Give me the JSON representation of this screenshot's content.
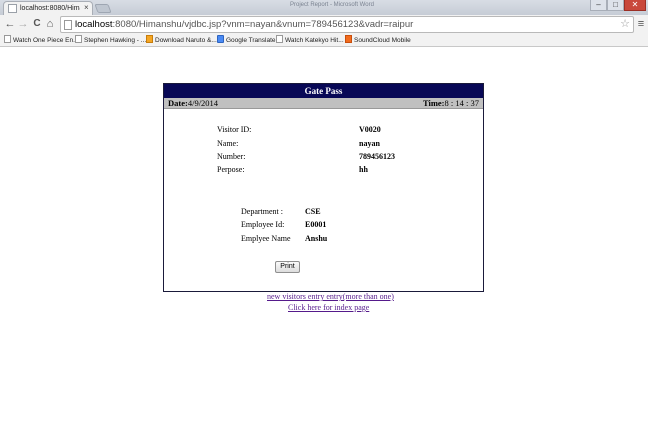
{
  "browser": {
    "tab_title": "localhost:8080/Himanshu",
    "tab_close": "×",
    "window_title": "Project Report - Microsoft Word",
    "controls": {
      "minimize": "–",
      "maximize": "□",
      "close": "✕"
    },
    "nav": {
      "back": "←",
      "forward": "→",
      "reload": "C",
      "home": "⌂"
    },
    "url_host": "localhost",
    "url_rest": ":8080/Himanshu/vjdbc.jsp?vnm=nayan&vnum=789456123&vadr=raipur",
    "star": "☆",
    "menu": "≡",
    "bookmarks": [
      {
        "label": "Watch One Piece En...",
        "icon": "page-icon"
      },
      {
        "label": "Stephen Hawking - ...",
        "icon": "page-icon"
      },
      {
        "label": "Download Naruto &...",
        "icon": "naruto-icon"
      },
      {
        "label": "Google Translate",
        "icon": "google-translate-icon"
      },
      {
        "label": "Watch Katekyo Hit...",
        "icon": "page-icon"
      },
      {
        "label": "SoundCloud Mobile",
        "icon": "soundcloud-icon"
      }
    ]
  },
  "gatepass": {
    "title": "Gate Pass",
    "date_label": "Date:",
    "date_value": "4/9/2014",
    "time_label": "Time:",
    "time_value": "8 : 14 : 37",
    "visitor": [
      {
        "label": "Visitor ID:",
        "value": "V0020"
      },
      {
        "label": "Name:",
        "value": "nayan"
      },
      {
        "label": "Number:",
        "value": "789456123"
      },
      {
        "label": "Perpose:",
        "value": "hh"
      }
    ],
    "employee": [
      {
        "label": "Department :",
        "value": "CSE"
      },
      {
        "label": "Employee Id:",
        "value": "E0001"
      },
      {
        "label": "Emplyee Name",
        "value": "Anshu"
      }
    ],
    "print_label": "Print"
  },
  "links": {
    "new_entry": "new visitors entry entry(more than one)",
    "index_page": "Click here for index page"
  },
  "colors": {
    "header_bg": "#080856",
    "date_row_bg": "#c0c0c0",
    "link": "#551a8b"
  }
}
